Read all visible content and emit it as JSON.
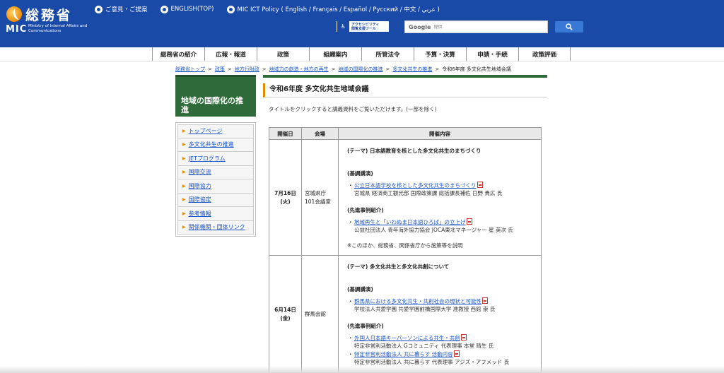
{
  "header": {
    "logo_kanji": "総務省",
    "logo_mic": "MIC",
    "logo_sub": "Ministry of Internal Affairs and Communications",
    "links": [
      {
        "label": "ご意見・ご提案"
      },
      {
        "label": "ENGLISH(TOP)"
      },
      {
        "label": "MIC ICT Policy ( English / Français / Español / Русский / 中文 / عربي )"
      }
    ],
    "access_badge": {
      "line1": "アクセシビリティ",
      "line2": "閲覧支援ツール"
    },
    "search": {
      "brand": "Google",
      "placeholder": "提供"
    }
  },
  "gnav": [
    {
      "label": "総務省の紹介"
    },
    {
      "label": "広報・報道"
    },
    {
      "label": "政策"
    },
    {
      "label": "組織案内"
    },
    {
      "label": "所管法令"
    },
    {
      "label": "予算・決算"
    },
    {
      "label": "申請・手続"
    },
    {
      "label": "政策評価"
    }
  ],
  "breadcrumb": {
    "links": [
      "総務省トップ",
      "政策",
      "地方行財政",
      "地域力の創造・地方の再生",
      "地域の国際化の推進",
      "多文化共生の推進"
    ],
    "separator": ">",
    "current": "令和6年度 多文化共生地域会議"
  },
  "sidebar": {
    "title": "地域の国際化の推進",
    "arrow": "▶",
    "items": [
      {
        "label": "トップページ"
      },
      {
        "label": "多文化共生の推進"
      },
      {
        "label": "JETプログラム"
      },
      {
        "label": "国際交流"
      },
      {
        "label": "国際協力"
      },
      {
        "label": "国際協定"
      },
      {
        "label": "参考情報"
      },
      {
        "label": "関係機関・団体リンク"
      }
    ]
  },
  "main": {
    "title": "令和6年度 多文化共生地域会議",
    "intro": "タイトルをクリックすると講義資料をご覧いただけます。(一部を除く)",
    "table": {
      "headers": [
        "開催日",
        "会場",
        "開催内容"
      ],
      "bullet": "・",
      "rows": [
        {
          "date": "7月16日",
          "day": "(火)",
          "venue_line1": "宮城県庁",
          "venue_line2": "101会議室",
          "theme": "(テーマ) 日本語教育を核とした多文化共生のまちづくり",
          "keynote_label": "(基調講演)",
          "keynote": [
            {
              "title": "公立日本語学校を核とした多文化共生のまちづくり",
              "speaker": "宮城県 経済商工観光部 国際政策課 総括課長補佐 日野 貴広 氏"
            }
          ],
          "case_label": "(先進事例紹介)",
          "cases": [
            {
              "title": "地域再生と「いわぬま日本語ひろば」の立上げ",
              "speaker": "公益社団法人 青年海外協力協会 JOCA東北マネージャー 星 英次 氏"
            }
          ],
          "note": "※このほか、総務省、関係省庁から施策等を説明"
        },
        {
          "date": "6月14日",
          "day": "(金)",
          "venue_line1": "群馬会館",
          "venue_line2": "",
          "theme": "(テーマ) 多文化共生と多文化共創について",
          "keynote_label": "(基調講演)",
          "keynote": [
            {
              "title": "群馬県における多文化共生・共創社会の現状と可能性",
              "speaker": "学校法人共愛学園 共愛学園前橋国際大学 准教授 西館 崇 氏"
            }
          ],
          "case_label": "(先進事例紹介)",
          "cases": [
            {
              "title": "外国人日本語キーパーソンによる共生・共創",
              "speaker": "特定非営利活動法人 Gコミュニティ 代表理事 本堂 晴生 氏"
            },
            {
              "title": "特定非営利活動法人 共に暮らす 活動内容",
              "speaker": "特定非営利活動法人 共に暮らす 代表理事 アジズ・アフメッド 氏"
            }
          ]
        }
      ]
    }
  }
}
